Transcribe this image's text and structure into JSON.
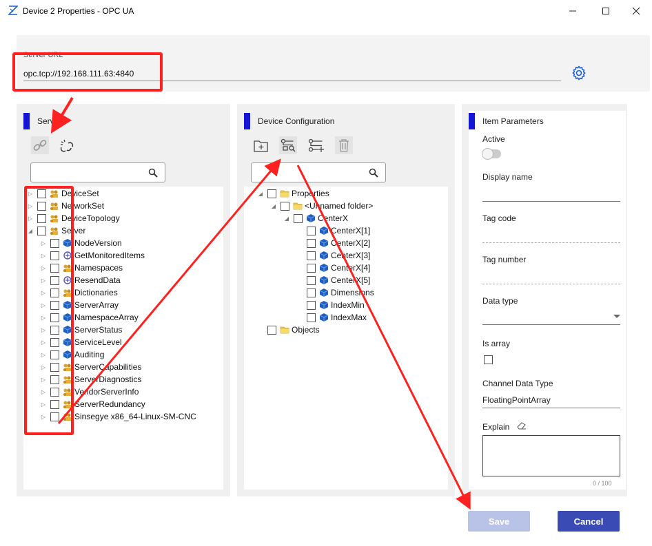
{
  "window": {
    "title": "Device 2 Properties - OPC UA",
    "minimize_icon": "minimize-icon",
    "maximize_icon": "maximize-icon",
    "close_icon": "close-icon"
  },
  "server_url": {
    "label": "Server URL",
    "value": "opc.tcp://192.168.111.63:4840",
    "settings_icon": "gear-icon"
  },
  "server_panel": {
    "title": "Server",
    "connect_icon": "link-icon",
    "disconnect_icon": "unlink-icon",
    "search_placeholder": "",
    "items": [
      {
        "label": "DeviceSet",
        "icon": "object-folder-icon"
      },
      {
        "label": "NetworkSet",
        "icon": "object-folder-icon"
      },
      {
        "label": "DeviceTopology",
        "icon": "object-folder-icon"
      },
      {
        "label": "Server",
        "icon": "object-folder-icon",
        "expanded": true
      },
      {
        "label": "NodeVersion",
        "icon": "variable-icon"
      },
      {
        "label": "GetMonitoredItems",
        "icon": "method-icon"
      },
      {
        "label": "Namespaces",
        "icon": "object-folder-icon"
      },
      {
        "label": "ResendData",
        "icon": "method-icon"
      },
      {
        "label": "Dictionaries",
        "icon": "object-folder-icon"
      },
      {
        "label": "ServerArray",
        "icon": "variable-icon"
      },
      {
        "label": "NamespaceArray",
        "icon": "variable-icon"
      },
      {
        "label": "ServerStatus",
        "icon": "variable-icon"
      },
      {
        "label": "ServiceLevel",
        "icon": "variable-icon"
      },
      {
        "label": "Auditing",
        "icon": "variable-icon"
      },
      {
        "label": "ServerCapabilities",
        "icon": "object-folder-icon"
      },
      {
        "label": "ServerDiagnostics",
        "icon": "object-folder-icon"
      },
      {
        "label": "VendorServerInfo",
        "icon": "object-folder-icon"
      },
      {
        "label": "ServerRedundancy",
        "icon": "object-folder-icon"
      },
      {
        "label": "Sinsegye x86_64-Linux-SM-CNC",
        "icon": "object-folder-icon"
      }
    ]
  },
  "device_config_panel": {
    "title": "Device Configuration",
    "tools": [
      "add-folder-icon",
      "map-tag-icon",
      "add-tag-icon",
      "delete-icon"
    ],
    "search_placeholder": "",
    "items": [
      {
        "label": "Properties",
        "icon": "folder-icon"
      },
      {
        "label": "<Unnamed folder>",
        "icon": "folder-icon"
      },
      {
        "label": "CenterX",
        "icon": "variable-icon"
      },
      {
        "label": "CenterX[1]",
        "icon": "variable-icon"
      },
      {
        "label": "CenterX[2]",
        "icon": "variable-icon"
      },
      {
        "label": "CenterX[3]",
        "icon": "variable-icon"
      },
      {
        "label": "CenterX[4]",
        "icon": "variable-icon"
      },
      {
        "label": "CenterX[5]",
        "icon": "variable-icon"
      },
      {
        "label": "Dimensions",
        "icon": "variable-icon"
      },
      {
        "label": "IndexMin",
        "icon": "variable-icon"
      },
      {
        "label": "IndexMax",
        "icon": "variable-icon"
      },
      {
        "label": "Objects",
        "icon": "folder-icon"
      }
    ]
  },
  "item_parameters": {
    "title": "Item Parameters",
    "active_label": "Active",
    "display_name_label": "Display name",
    "display_name_value": "",
    "tag_code_label": "Tag code",
    "tag_code_value": "",
    "tag_number_label": "Tag number",
    "tag_number_value": "",
    "data_type_label": "Data type",
    "data_type_value": "",
    "is_array_label": "Is array",
    "channel_data_type_label": "Channel Data Type",
    "channel_data_type_value": "FloatingPointArray",
    "explain_label": "Explain",
    "explain_value": "",
    "explain_counter": "0 / 100"
  },
  "buttons": {
    "save": "Save",
    "cancel": "Cancel"
  },
  "colors": {
    "accent_bar": "#1515d6",
    "primary_button": "#3a4bb5",
    "disabled_button": "#b9c2e7",
    "annotation_red": "#ff2020"
  }
}
